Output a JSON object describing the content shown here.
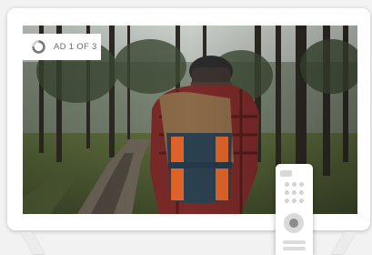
{
  "ad": {
    "label": "AD 1 OF 3",
    "progress_fraction": 0.75
  },
  "screen": {
    "description_icon": "photo-forest-hiker"
  },
  "colors": {
    "frame": "#ffffff",
    "background": "#f2f2f2",
    "badge_text": "#6b6b6b",
    "ring_track": "#d0d0d0",
    "ring_fill": "#7a7a7a"
  },
  "remote": {
    "icon": "tv-remote-icon"
  }
}
